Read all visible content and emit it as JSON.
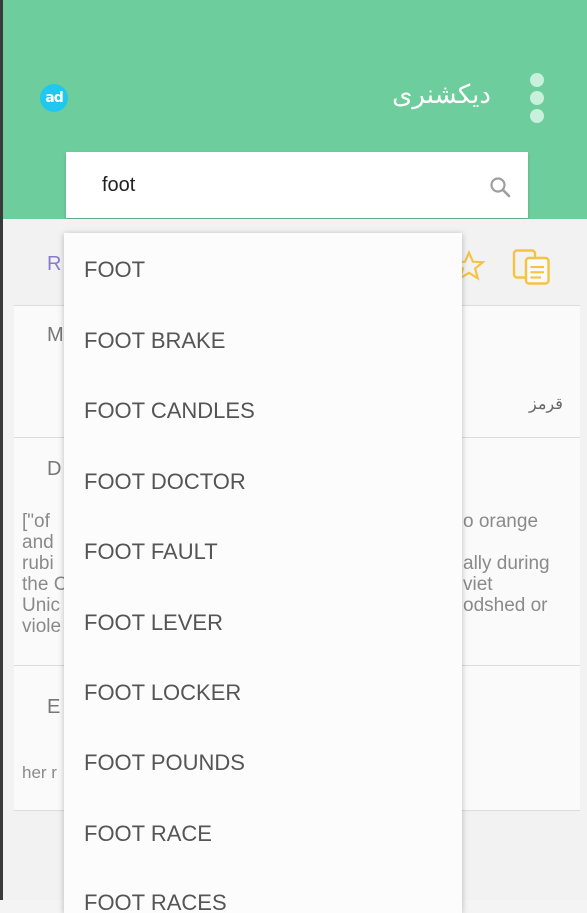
{
  "header": {
    "title": "دیکشنری",
    "ad_icon_text": "ad",
    "background_color": "#6ecd9c",
    "menu_icon": "more-vertical-icon"
  },
  "search": {
    "value": "foot",
    "icon": "search-icon"
  },
  "suggestions": [
    "FOOT",
    "FOOT BRAKE",
    "FOOT CANDLES",
    "FOOT DOCTOR",
    "FOOT FAULT",
    "FOOT LEVER",
    "FOOT LOCKER",
    "FOOT POUNDS",
    "FOOT RACE",
    "FOOT RACES"
  ],
  "background": {
    "word_row": {
      "initial": "R",
      "star_icon": "star-outline-icon",
      "copy_icon": "copy-icon",
      "icon_color": "#f5c342"
    },
    "meaning": {
      "initial": "M",
      "translation": "قرمز"
    },
    "definition": {
      "initial": "D",
      "left_fragments": [
        "[\"of",
        "and",
        "rubi",
        "the C",
        "Unic",
        "viole"
      ],
      "right_fragments": [
        "o orange",
        "ally during",
        "viet",
        "odshed or"
      ]
    },
    "example": {
      "initial": "E",
      "text_fragment": "her r"
    }
  }
}
